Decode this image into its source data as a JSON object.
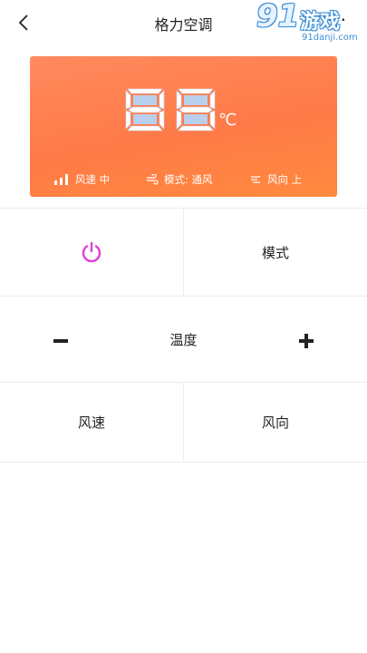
{
  "header": {
    "title": "格力空调",
    "more_label": "···",
    "back_icon": "chevron-left-icon"
  },
  "watermark": {
    "logo_number": "91",
    "logo_text": "游戏",
    "url": "91danji.com"
  },
  "display": {
    "temperature": "88",
    "unit": "℃",
    "fan_speed": "风速 中",
    "mode": "模式: 通风",
    "direction": "风向 上"
  },
  "controls": {
    "power_icon": "power-icon",
    "mode_label": "模式",
    "temp_label": "温度",
    "fan_speed_label": "风速",
    "direction_label": "风向"
  },
  "colors": {
    "panel_orange": "#ff7a47",
    "power_magenta": "#e040d8",
    "watermark_blue": "#3b8fd6"
  }
}
